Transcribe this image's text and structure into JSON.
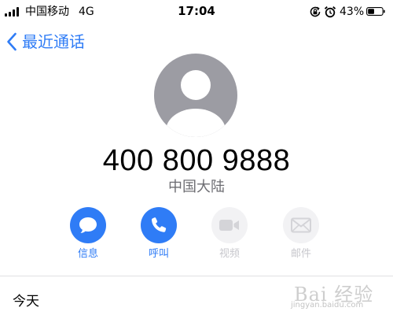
{
  "status_bar": {
    "carrier": "中国移动",
    "network": "4G",
    "time": "17:04",
    "battery_percent": "43%",
    "icons": [
      "signal-bars-icon",
      "orientation-lock-icon",
      "alarm-clock-icon",
      "battery-icon"
    ]
  },
  "nav": {
    "back_label": "最近通话"
  },
  "contact": {
    "phone_number": "400 800 9888",
    "location": "中国大陆"
  },
  "actions": [
    {
      "label": "信息",
      "icon": "message-bubble-icon",
      "enabled": true
    },
    {
      "label": "呼叫",
      "icon": "phone-icon",
      "enabled": true
    },
    {
      "label": "视频",
      "icon": "video-camera-icon",
      "enabled": false
    },
    {
      "label": "邮件",
      "icon": "mail-envelope-icon",
      "enabled": false
    }
  ],
  "history": {
    "section_title": "今天"
  },
  "watermark": {
    "main": "Bai 经验",
    "sub": "jingyan.baidu.com"
  },
  "colors": {
    "accent": "#2f7cf6",
    "disabled": "#c7c7cc",
    "secondary_text": "#6d6d72",
    "avatar": "#9c9ca3"
  }
}
